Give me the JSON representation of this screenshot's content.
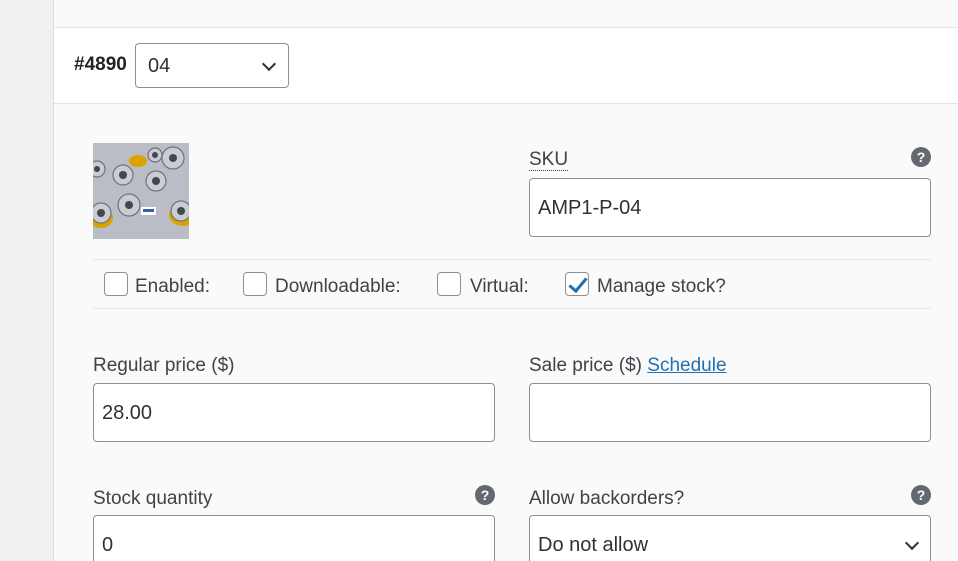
{
  "variation": {
    "id": "#4890",
    "selected": "04"
  },
  "sku": {
    "label": "SKU",
    "value": "AMP1-P-04"
  },
  "checkboxes": [
    {
      "label": "Enabled:",
      "checked": false
    },
    {
      "label": "Downloadable:",
      "checked": false
    },
    {
      "label": "Virtual:",
      "checked": false
    },
    {
      "label": "Manage stock?",
      "checked": true
    }
  ],
  "regular_price": {
    "label": "Regular price ($)",
    "value": "28.00"
  },
  "sale_price": {
    "label": "Sale price ($)",
    "schedule_link": "Schedule",
    "value": ""
  },
  "stock_quantity": {
    "label": "Stock quantity",
    "value": "0"
  },
  "backorders": {
    "label": "Allow backorders?",
    "selected": "Do not allow"
  },
  "help_glyph": "?",
  "colors": {
    "accent": "#2271b1",
    "border": "#8c8f94",
    "help_bg": "#646970"
  }
}
